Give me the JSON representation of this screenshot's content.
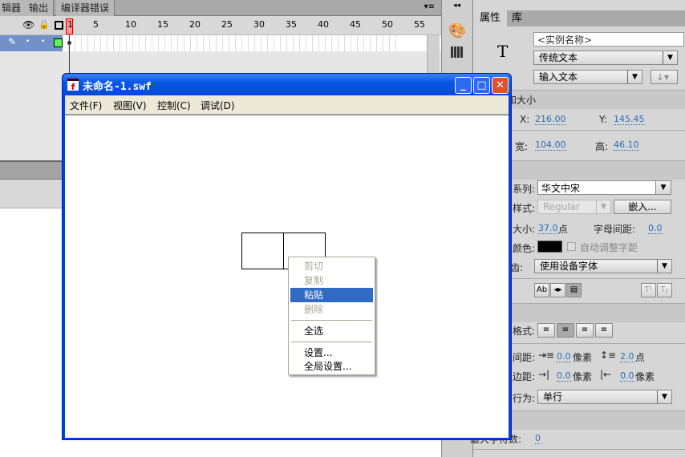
{
  "timeline": {
    "tabs": [
      "辑器",
      "输出",
      "编译器错误"
    ],
    "frame_numbers": [
      "1",
      "5",
      "10",
      "15",
      "20",
      "25",
      "30",
      "35",
      "40",
      "45",
      "50",
      "55"
    ],
    "menu_icon": "panel-menu-icon"
  },
  "properties": {
    "tabs": [
      "属性",
      "库"
    ],
    "instance_name_placeholder": "<实例名称>",
    "text_engine": "传统文本",
    "text_type": "输入文本",
    "symbol": "T",
    "section_position": "位置和大小",
    "x_label": "X:",
    "x_value": "216.00",
    "y_label": "Y:",
    "y_value": "145.45",
    "w_label": "宽:",
    "w_value": "104.00",
    "h_label": "高:",
    "h_value": "46.10",
    "family_label": "系列:",
    "family_value": "华文中宋",
    "style_label": "样式:",
    "style_value": "Regular",
    "embed_button": "嵌入...",
    "size_label": "大小:",
    "size_value": "37.0",
    "size_unit": "点",
    "spacing_label": "字母间距:",
    "spacing_value": "0.0",
    "color_label": "颜色:",
    "text_color": "#000000",
    "auto_kern": "自动调整字距",
    "aa_label": "消除锯齿:",
    "aa_value": "使用设备字体",
    "format_label": "格式:",
    "indent_label": "间距:",
    "indent_value": "0.0",
    "indent_unit": "像素",
    "line_value": "2.0",
    "line_unit": "点",
    "margin_label": "边距:",
    "margin_left": "0.0",
    "margin_left_unit": "像素",
    "margin_right": "0.0",
    "margin_right_unit": "像素",
    "behavior_label": "行为:",
    "behavior_value": "单行",
    "maxchars_label": "最大字符数:",
    "maxchars_value": "0"
  },
  "window": {
    "title": "未命名-1.swf",
    "menu": [
      "文件(F)",
      "视图(V)",
      "控制(C)",
      "调试(D)"
    ]
  },
  "context_menu": {
    "items": [
      {
        "label": "剪切",
        "disabled": true
      },
      {
        "label": "复制",
        "disabled": true
      },
      {
        "label": "粘贴",
        "selected": true
      },
      {
        "label": "删除",
        "disabled": true
      },
      {
        "label": "全选"
      },
      {
        "label": "设置..."
      },
      {
        "label": "全局设置..."
      }
    ]
  },
  "colors": {
    "selection": "#316ac5",
    "titlebar": "#0a56e4",
    "layer_row": "#7391c9",
    "playhead": "#ff9a9a"
  }
}
